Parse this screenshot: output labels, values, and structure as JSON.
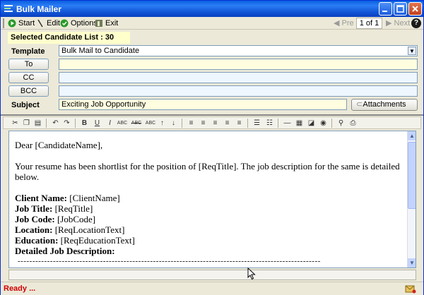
{
  "window": {
    "title": "Bulk Mailer"
  },
  "menu": {
    "items": [
      {
        "label": "Start",
        "icon": "start-icon"
      },
      {
        "label": "Edit",
        "icon": "edit-icon"
      },
      {
        "label": "Options",
        "icon": "options-icon"
      },
      {
        "label": "Exit",
        "icon": "exit-icon"
      }
    ],
    "pager": {
      "prev": "Pre",
      "page": "1 of 1",
      "next": "Next"
    }
  },
  "form": {
    "selected_list": "Selected Candidate List : 30",
    "template_label": "Template",
    "template_value": "Bulk Mail to Candidate",
    "to_label": "To",
    "to_value": "",
    "cc_label": "CC",
    "cc_value": "",
    "bcc_label": "BCC",
    "bcc_value": "",
    "subject_label": "Subject",
    "subject_value": "Exciting Job Opportunity",
    "attachments_label": "Attachments"
  },
  "editor": {
    "greeting": "Dear [CandidateName],",
    "intro": "Your resume has been shortlist for the position of [ReqTitle]. The job description for the same is detailed below.",
    "fields": [
      {
        "label": "Client Name:",
        "value": " [ClientName]"
      },
      {
        "label": "Job Title:",
        "value": " [ReqTitle]"
      },
      {
        "label": "Job Code:",
        "value": " [JobCode]"
      },
      {
        "label": "Location:",
        "value": " [ReqLocationText]"
      },
      {
        "label": "Education:",
        "value": " [ReqEducationText]"
      },
      {
        "label": "Detailed Job Description:",
        "value": ""
      }
    ],
    "divider": "-------------------------------------------------------------------------------------------------------"
  },
  "status": {
    "text": "Ready ..."
  }
}
